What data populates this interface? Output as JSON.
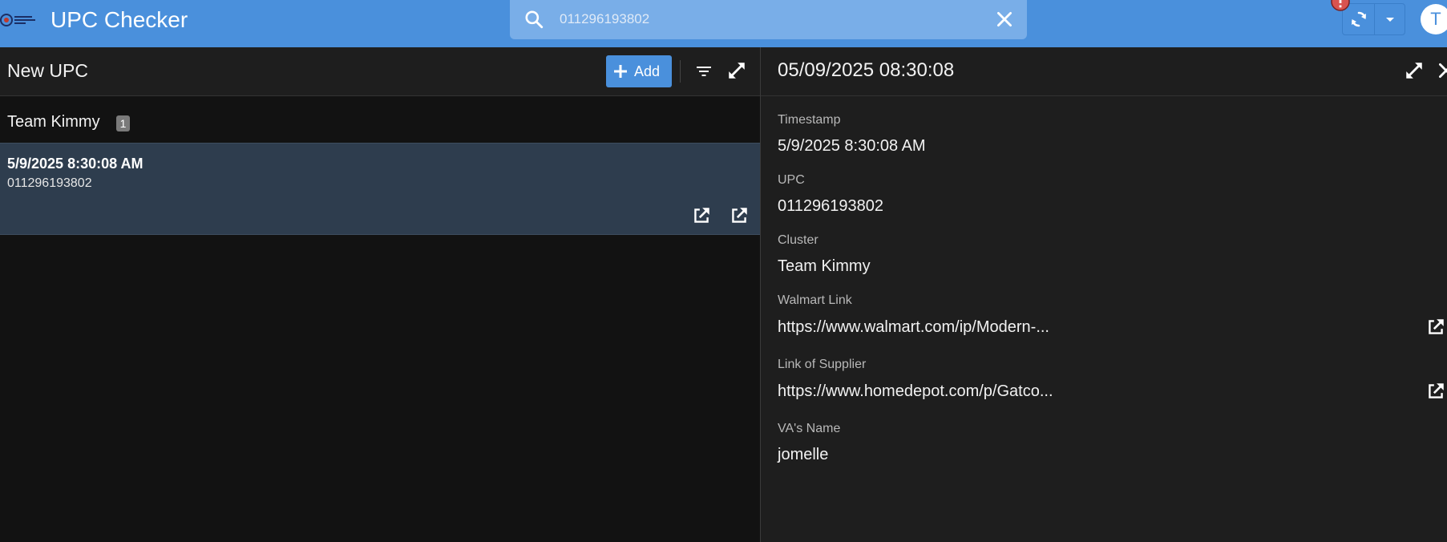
{
  "app": {
    "title": "UPC Checker"
  },
  "search": {
    "value": "011296193802"
  },
  "user": {
    "avatar_initial": "T"
  },
  "list_panel": {
    "title": "New UPC",
    "add_label": "Add",
    "group": {
      "name": "Team Kimmy",
      "count": "1"
    },
    "records": [
      {
        "date": "5/9/2025 8:30:08 AM",
        "upc": "011296193802"
      }
    ]
  },
  "detail_panel": {
    "title": "05/09/2025 08:30:08",
    "fields": [
      {
        "label": "Timestamp",
        "value": "5/9/2025 8:30:08 AM"
      },
      {
        "label": "UPC",
        "value": "011296193802"
      },
      {
        "label": "Cluster",
        "value": "Team Kimmy"
      },
      {
        "label": "Walmart Link",
        "value": "https://www.walmart.com/ip/Modern-..."
      },
      {
        "label": "Link of Supplier",
        "value": "https://www.homedepot.com/p/Gatco..."
      },
      {
        "label": "VA's Name",
        "value": "jomelle"
      }
    ]
  },
  "icons": {
    "search": "search-icon",
    "clear": "close-icon",
    "sync": "sync-icon",
    "dropdown": "caret-down-icon",
    "alert": "alert-icon",
    "add": "plus-icon",
    "filter": "filter-icon",
    "expand": "expand-icon",
    "open": "external-link-icon",
    "close": "close-icon"
  },
  "colors": {
    "accent": "#4a90dc",
    "bg": "#121212",
    "panel": "#1e1e1e",
    "row_selected": "#2e3d4e",
    "alert": "#d9534f"
  }
}
